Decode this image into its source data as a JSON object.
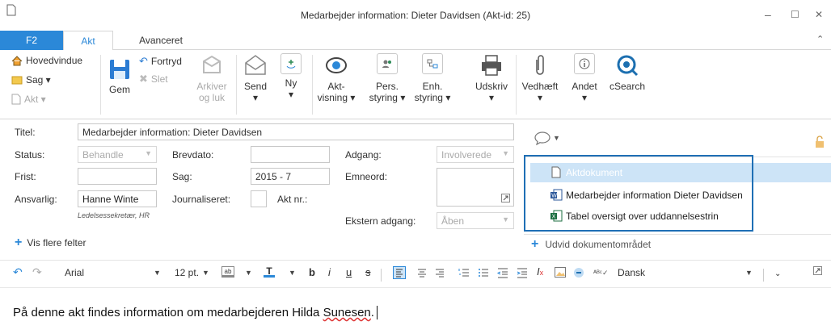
{
  "window": {
    "title": "Medarbejder information: Dieter Davidsen  (Akt-id: 25)",
    "minimize": "–",
    "maximize": "☐",
    "close": "✕",
    "collapse": "⌃"
  },
  "tabs": {
    "f2": "F2",
    "akt": "Akt",
    "avanceret": "Avanceret"
  },
  "ribbon": {
    "hovedvindue": "Hovedvindue",
    "sag": "Sag ▾",
    "akt": "Akt ▾",
    "gem": "Gem",
    "fortryd": "Fortryd",
    "slet": "Slet",
    "arkiver_line1": "Arkiver",
    "arkiver_line2": "og luk",
    "send_line1": "Send",
    "send_line2": "▾",
    "ny_line1": "Ny",
    "ny_line2": "▾",
    "aktvisning_line1": "Akt-",
    "aktvisning_line2": "visning ▾",
    "persstyring_line1": "Pers.",
    "persstyring_line2": "styring ▾",
    "enhstyring_line1": "Enh.",
    "enhstyring_line2": "styring ▾",
    "udskriv_line1": "Udskriv",
    "udskriv_line2": "▾",
    "vedhaeft_line1": "Vedhæft",
    "vedhaeft_line2": "▾",
    "andet_line1": "Andet",
    "andet_line2": "▾",
    "csearch": "cSearch"
  },
  "form": {
    "titel_label": "Titel:",
    "titel_value": "Medarbejder information: Dieter Davidsen",
    "status_label": "Status:",
    "status_value": "Behandle",
    "brevdato_label": "Brevdato:",
    "brevdato_value": "",
    "adgang_label": "Adgang:",
    "adgang_value": "Involverede",
    "frist_label": "Frist:",
    "frist_value": "",
    "sag_label": "Sag:",
    "sag_value": "2015 - 7",
    "emneord_label": "Emneord:",
    "ansvarlig_label": "Ansvarlig:",
    "ansvarlig_value": "Hanne Winte",
    "ansvarlig_sub": "Ledelsessekretær, HR",
    "journaliseret_label": "Journaliseret:",
    "aktnr_label": "Akt nr.:",
    "ekstern_label": "Ekstern adgang:",
    "ekstern_value": "Åben",
    "vis_flere": "Vis flere felter"
  },
  "documents": {
    "items": [
      {
        "label": "Aktdokument",
        "icon": "blank-document-icon"
      },
      {
        "label": "Medarbejder information Dieter Davidsen",
        "icon": "word-document-icon"
      },
      {
        "label": "Tabel oversigt over uddannelsestrin",
        "icon": "excel-document-icon"
      }
    ],
    "udvid": "Udvid dokumentområdet"
  },
  "toolbar": {
    "font": "Arial",
    "size": "12 pt.",
    "language": "Dansk"
  },
  "editor": {
    "text_before": "På denne akt findes information om medarbejderen Hilda ",
    "text_underlined": "Sunesen",
    "text_after": "."
  },
  "colors": {
    "accent": "#2b88d8",
    "selected_row": "#cde4f7",
    "highlight_border": "#1f6fb5",
    "green_plus": "#2e8b57",
    "excel": "#1d6f42",
    "word": "#2b579a"
  }
}
